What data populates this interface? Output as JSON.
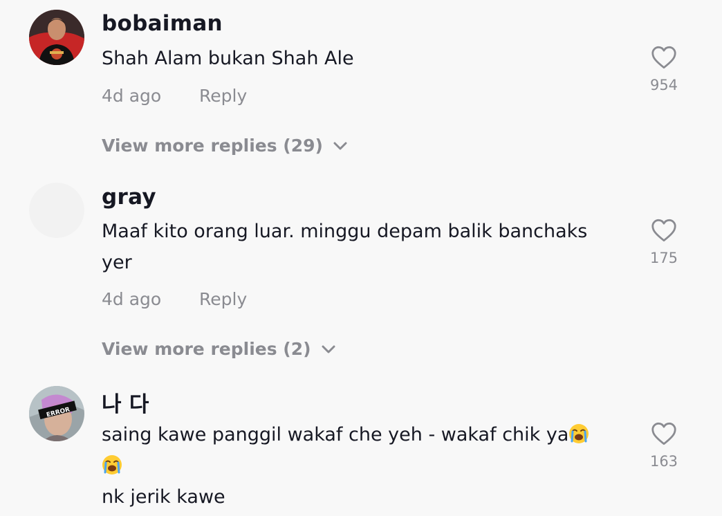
{
  "comments": [
    {
      "username": "bobaiman",
      "text_lines": [
        "Shah Alam bukan Shah Ale"
      ],
      "time": "4d ago",
      "reply_label": "Reply",
      "likes": "954",
      "view_more": "View more replies (29)"
    },
    {
      "username": "gray",
      "text_lines": [
        "Maaf kito orang luar. minggu depam balik banchaks",
        "yer"
      ],
      "time": "4d ago",
      "reply_label": "Reply",
      "likes": "175",
      "view_more": "View more replies (2)"
    },
    {
      "username": "나 다",
      "text_lines": [
        "saing kawe panggil wakaf che yeh - wakaf chik ya",
        "",
        "nk jerik kawe"
      ],
      "emoji": "loudly-crying-face",
      "likes": "163"
    }
  ],
  "colors": {
    "background": "#f8f8f8",
    "text": "#161823",
    "muted": "#8a8b91"
  },
  "icons": [
    "heart-outline-icon",
    "chevron-down-icon",
    "loudly-crying-face-emoji"
  ]
}
